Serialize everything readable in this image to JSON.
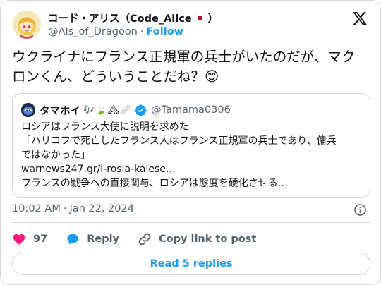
{
  "author": {
    "display_name": "コード・アリス（Code_Alice",
    "display_name_suffix": "）",
    "handle": "@AIs_of_Dragoon",
    "separator": "·",
    "follow_label": "Follow"
  },
  "tweet": {
    "text": "ウクライナにフランス正規軍の兵士がいたのだが、マクロンくん、どういうことだね？",
    "emoji": "😊"
  },
  "quote": {
    "display_name": "タマホイ",
    "emojis": "🎶🍃🏔🩹",
    "handle": "@Tamama0306",
    "lines": [
      "ロシアはフランス大使に説明を求めた",
      "「ハリコフで死亡したフランス人はフランス正規軍の兵士であり、傭兵",
      "ではなかった」",
      "warnews247.gr/i-rosia-kalese…",
      "フランスの戦争への直接関与、ロシアは態度を硬化させる…"
    ]
  },
  "meta": {
    "time": "10:02 AM",
    "separator": "·",
    "date": "Jan 22, 2024"
  },
  "actions": {
    "like_count": "97",
    "reply_label": "Reply",
    "copy_label": "Copy link to post"
  },
  "replies_button": "Read 5 replies",
  "colors": {
    "accent": "#1d9bf0",
    "like": "#f91880",
    "text": "#0f1419",
    "muted": "#536471",
    "border": "#cfd9de"
  },
  "icons": {
    "logo": "x-logo-icon",
    "info": "info-icon",
    "like": "heart-icon",
    "reply": "reply-bubble-icon",
    "copy": "link-icon",
    "verified": "verified-badge-icon"
  }
}
